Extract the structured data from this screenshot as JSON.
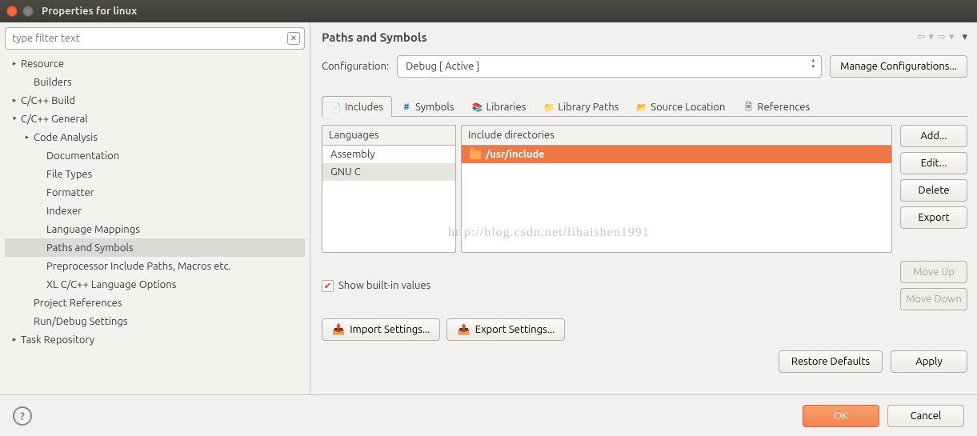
{
  "window": {
    "title": "Properties for linux"
  },
  "filter": {
    "placeholder": "type filter text"
  },
  "tree": [
    {
      "label": "Resource",
      "depth": 0,
      "twist": "▸"
    },
    {
      "label": "Builders",
      "depth": 1,
      "twist": ""
    },
    {
      "label": "C/C++ Build",
      "depth": 0,
      "twist": "▸"
    },
    {
      "label": "C/C++ General",
      "depth": 0,
      "twist": "▾"
    },
    {
      "label": "Code Analysis",
      "depth": 1,
      "twist": "▸"
    },
    {
      "label": "Documentation",
      "depth": 2,
      "twist": ""
    },
    {
      "label": "File Types",
      "depth": 2,
      "twist": ""
    },
    {
      "label": "Formatter",
      "depth": 2,
      "twist": ""
    },
    {
      "label": "Indexer",
      "depth": 2,
      "twist": ""
    },
    {
      "label": "Language Mappings",
      "depth": 2,
      "twist": ""
    },
    {
      "label": "Paths and Symbols",
      "depth": 2,
      "twist": "",
      "selected": true
    },
    {
      "label": "Preprocessor Include Paths, Macros etc.",
      "depth": 2,
      "twist": ""
    },
    {
      "label": "XL C/C++ Language Options",
      "depth": 2,
      "twist": ""
    },
    {
      "label": "Project References",
      "depth": 1,
      "twist": ""
    },
    {
      "label": "Run/Debug Settings",
      "depth": 1,
      "twist": ""
    },
    {
      "label": "Task Repository",
      "depth": 0,
      "twist": "▸"
    }
  ],
  "page": {
    "title": "Paths and Symbols"
  },
  "config": {
    "label": "Configuration:",
    "value": "Debug  [ Active ]",
    "manage": "Manage Configurations..."
  },
  "tabs": [
    {
      "label": "Includes",
      "icon": "📄",
      "active": true
    },
    {
      "label": "Symbols",
      "icon": "#",
      "active": false,
      "color": "#2f6fb3"
    },
    {
      "label": "Libraries",
      "icon": "📚",
      "active": false
    },
    {
      "label": "Library Paths",
      "icon": "📁",
      "active": false
    },
    {
      "label": "Source Location",
      "icon": "📂",
      "active": false
    },
    {
      "label": "References",
      "icon": "🗎",
      "active": false
    }
  ],
  "languages": {
    "header": "Languages",
    "items": [
      "Assembly",
      "GNU C"
    ],
    "selected": 1
  },
  "includes": {
    "header": "Include directories",
    "items": [
      "/usr/include"
    ],
    "selected": 0
  },
  "buttons": {
    "add": "Add...",
    "edit": "Edit...",
    "delete": "Delete",
    "export": "Export",
    "moveUp": "Move Up",
    "moveDown": "Move Down",
    "import": "Import Settings...",
    "exportSettings": "Export Settings...",
    "restore": "Restore Defaults",
    "apply": "Apply",
    "ok": "OK",
    "cancel": "Cancel"
  },
  "checkbox": {
    "label": "Show built-in values",
    "checked": true
  },
  "watermark": "http://blog.csdn.net/libaishen1991"
}
